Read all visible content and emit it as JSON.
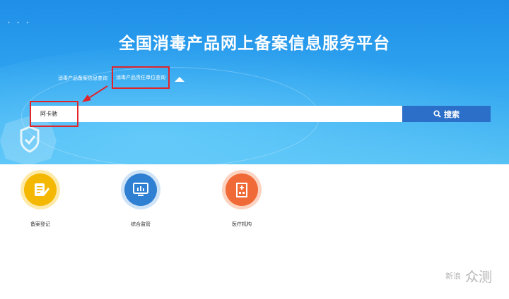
{
  "hero": {
    "title": "全国消毒产品网上备案信息服务平台",
    "tabs": [
      {
        "label": "消毒产品备案信息查询",
        "active": false
      },
      {
        "label": "消毒产品责任单位查询",
        "active": true
      }
    ]
  },
  "search": {
    "value": "阿卡驰",
    "button_label": "搜索",
    "button_icon": "search-icon"
  },
  "features": [
    {
      "label": "备案登记",
      "icon": "clipboard-pen-icon",
      "color": "#f5b800"
    },
    {
      "label": "综合监管",
      "icon": "monitor-chart-icon",
      "color": "#2f7fd3"
    },
    {
      "label": "医疗机构",
      "icon": "hospital-icon",
      "color": "#f06a37"
    }
  ],
  "watermark": {
    "line1": "新浪",
    "line2": "众测"
  },
  "colors": {
    "hero_top": "#1f8ee8",
    "hero_bottom": "#56c2f5",
    "search_button": "#2b6fc9",
    "highlight_red": "#e0252b"
  }
}
